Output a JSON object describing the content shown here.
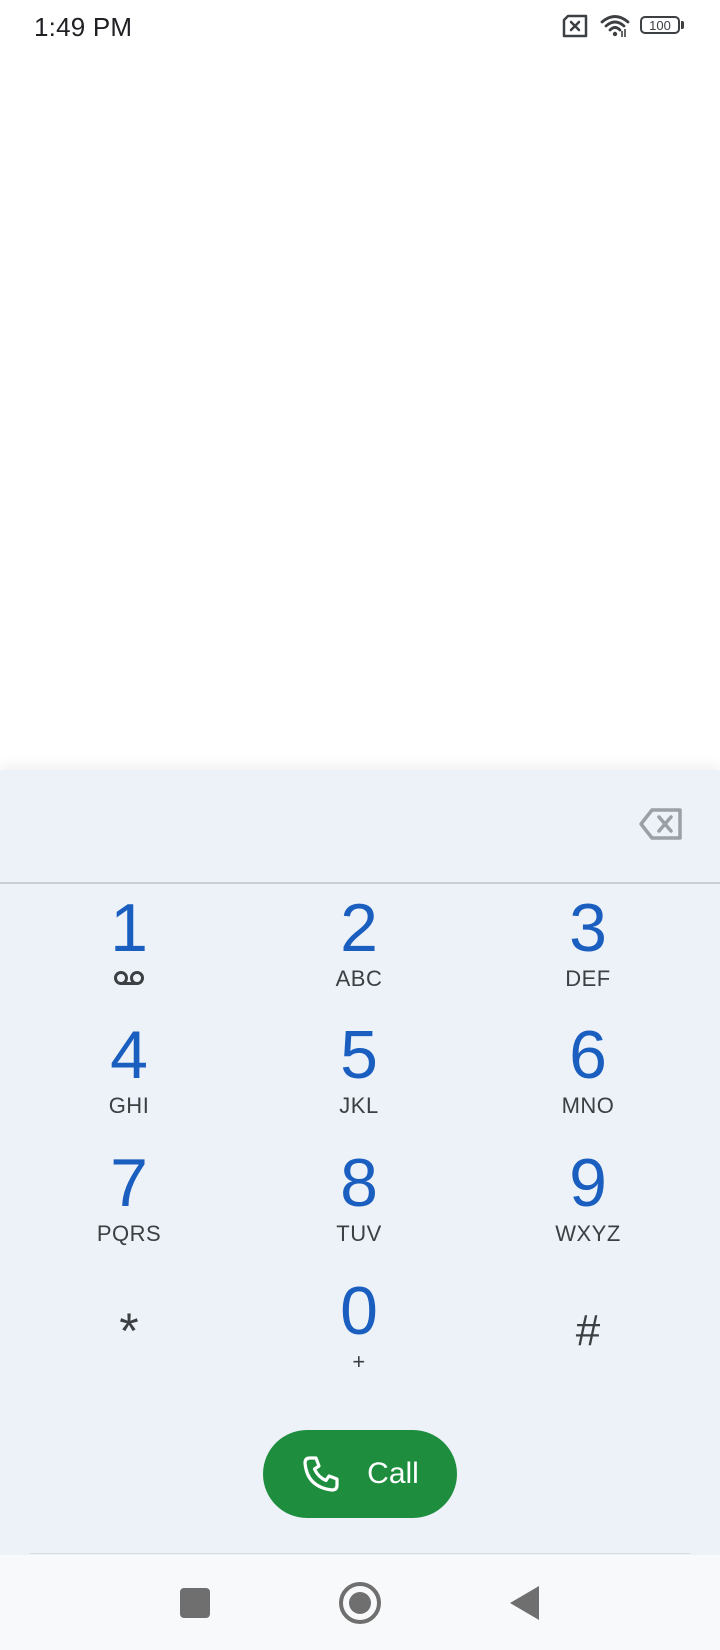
{
  "status_bar": {
    "time": "1:49 PM",
    "battery_level": "100",
    "icons": [
      "no-sim-icon",
      "wifi-icon",
      "battery-icon"
    ]
  },
  "dialpad": {
    "digits_value": "",
    "keys": [
      {
        "digit": "1",
        "letters": "",
        "icon": "voicemail-icon"
      },
      {
        "digit": "2",
        "letters": "ABC"
      },
      {
        "digit": "3",
        "letters": "DEF"
      },
      {
        "digit": "4",
        "letters": "GHI"
      },
      {
        "digit": "5",
        "letters": "JKL"
      },
      {
        "digit": "6",
        "letters": "MNO"
      },
      {
        "digit": "7",
        "letters": "PQRS"
      },
      {
        "digit": "8",
        "letters": "TUV"
      },
      {
        "digit": "9",
        "letters": "WXYZ"
      },
      {
        "symbol": "*"
      },
      {
        "digit": "0",
        "letters": "+"
      },
      {
        "symbol": "#"
      }
    ],
    "call_label": "Call"
  },
  "colors": {
    "digit_blue": "#1a5fbf",
    "call_green": "#1e8e3e",
    "sheet_bg": "#edf2f9"
  },
  "nav": {
    "icons": [
      "recents-square-icon",
      "home-circle-icon",
      "back-triangle-icon"
    ]
  }
}
